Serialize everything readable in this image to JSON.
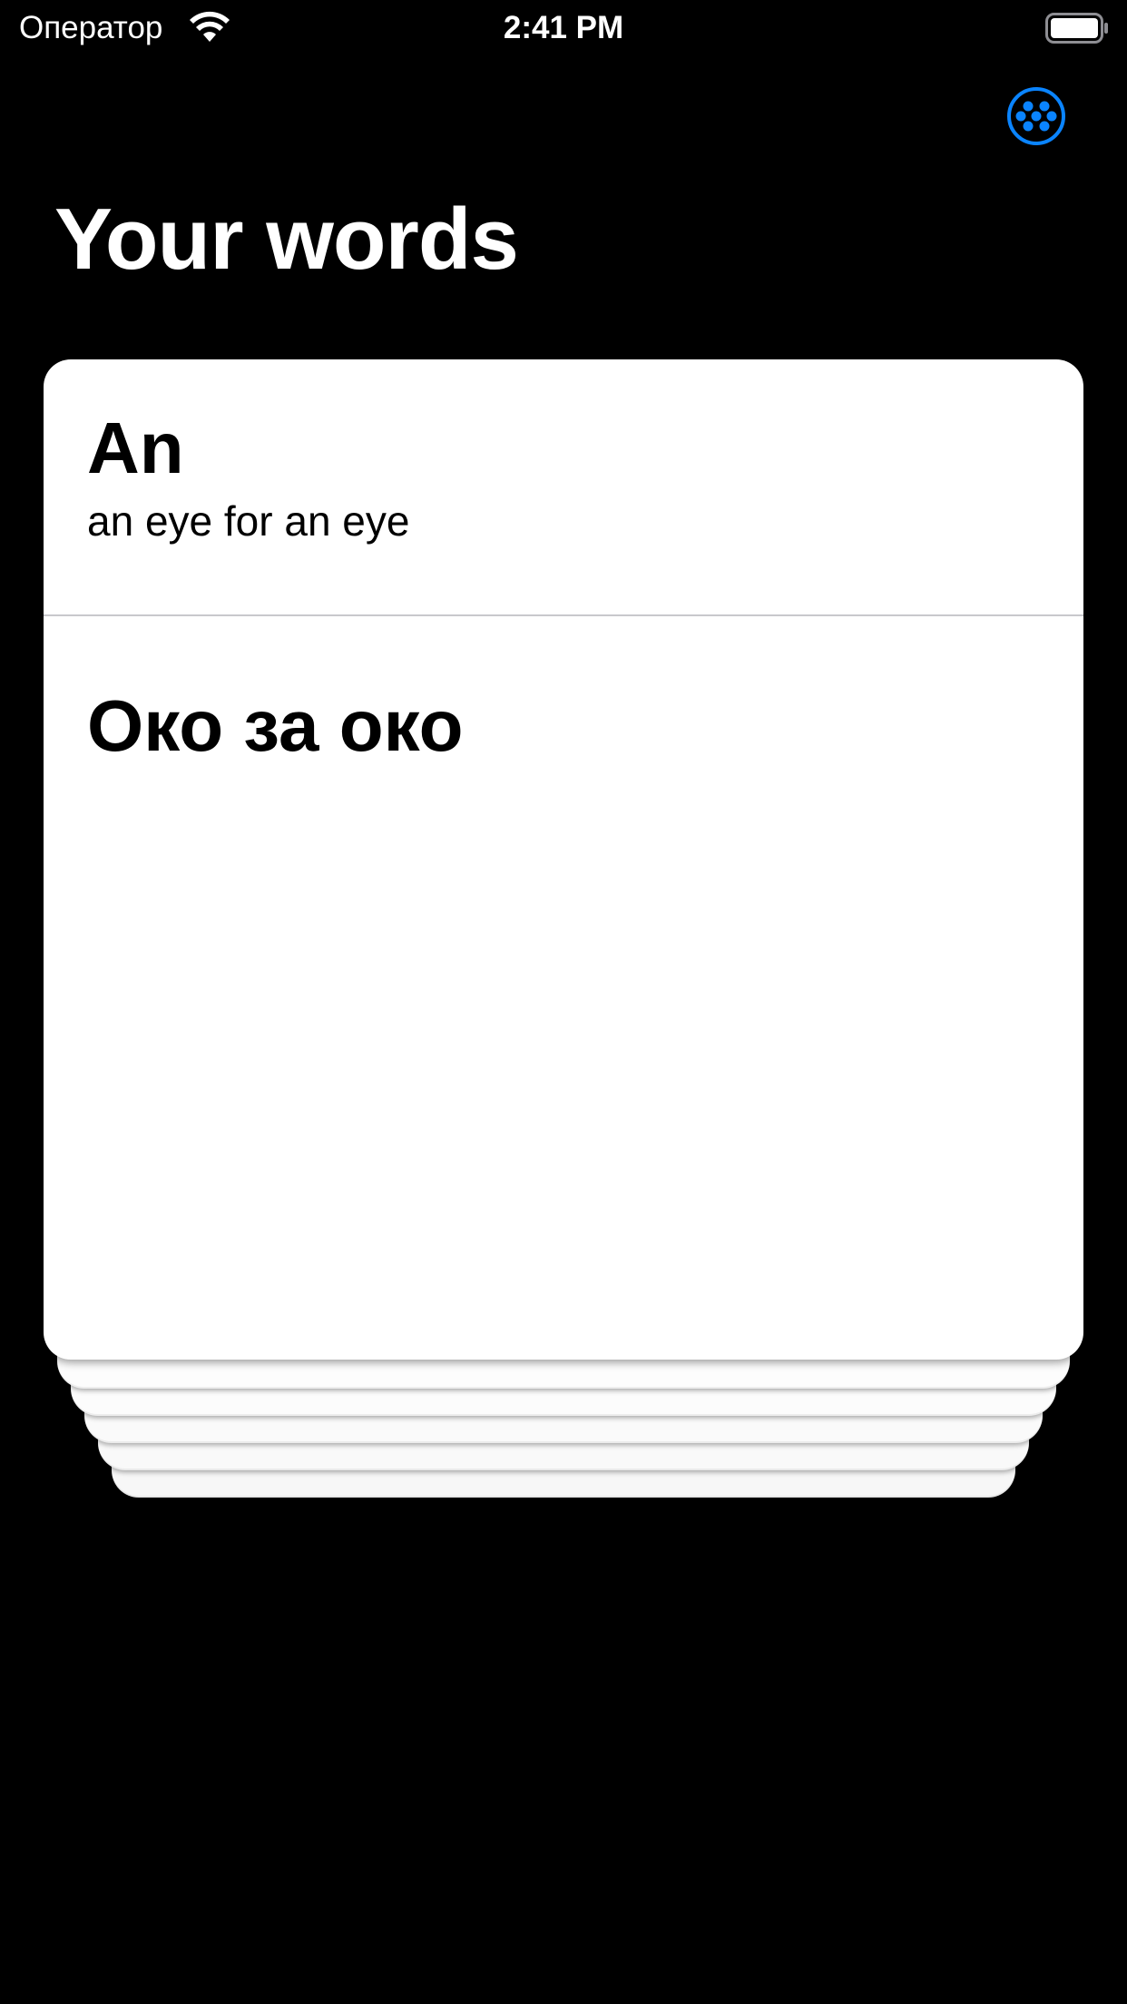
{
  "status_bar": {
    "carrier": "Оператор",
    "time": "2:41 PM",
    "wifi_icon": "wifi-icon",
    "battery_icon": "battery-icon"
  },
  "toolbar": {
    "options_icon": "dots-grid-icon",
    "accent_color": "#0a84ff"
  },
  "header": {
    "title": "Your words"
  },
  "card": {
    "word": "An",
    "example": "an eye for an eye",
    "translation": "Око за око"
  },
  "colors": {
    "background": "#000000",
    "card": "#ffffff",
    "divider": "#c8c8cc"
  }
}
